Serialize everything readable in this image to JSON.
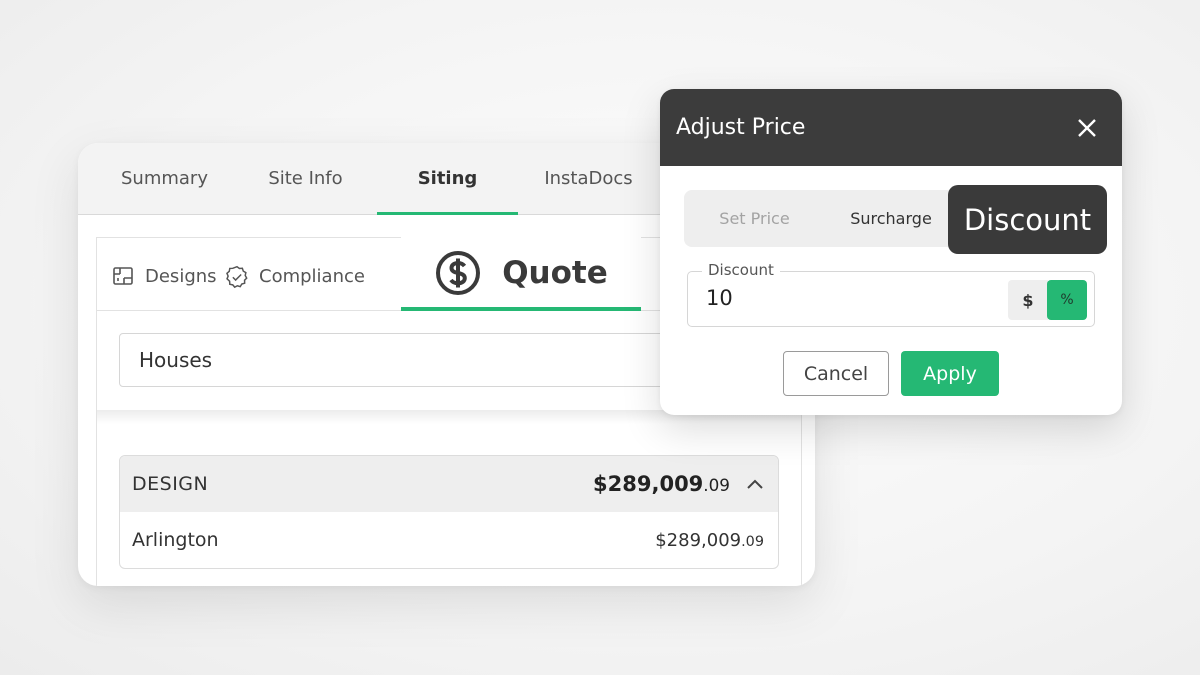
{
  "tabs": [
    {
      "label": "Summary"
    },
    {
      "label": "Site Info"
    },
    {
      "label": "Siting"
    },
    {
      "label": "InstaDocs"
    }
  ],
  "active_tab": "Siting",
  "subtabs": {
    "designs": "Designs",
    "compliance": "Compliance",
    "quote": "Quote"
  },
  "search": {
    "value": "Houses"
  },
  "design_section": {
    "label": "DESIGN",
    "total_main": "$289,009",
    "total_cents": ".09",
    "items": [
      {
        "name": "Arlington",
        "price_main": "$289,009",
        "price_cents": ".09"
      }
    ]
  },
  "modal": {
    "title": "Adjust Price",
    "segments": {
      "set_price": "Set Price",
      "surcharge": "Surcharge",
      "discount": "Discount"
    },
    "selected_segment": "Discount",
    "field": {
      "label": "Discount",
      "value": "10"
    },
    "unit_options": {
      "dollar": "$",
      "percent": "%"
    },
    "selected_unit": "%",
    "cancel_label": "Cancel",
    "apply_label": "Apply"
  },
  "colors": {
    "accent": "#25b874",
    "modal_header": "#3c3c3c",
    "tab_bar": "#f3f3f3"
  }
}
